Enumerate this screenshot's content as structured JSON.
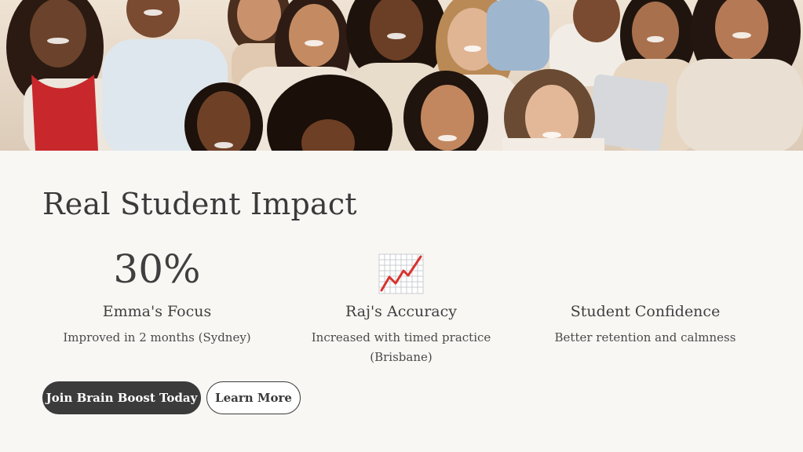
{
  "hero": {
    "image_alt": "Group of smiling students"
  },
  "impact": {
    "title": "Real Student Impact",
    "stats": [
      {
        "value": "30%",
        "heading": "Emma's Focus",
        "description": "Improved in 2 months (Sydney)"
      },
      {
        "icon": "chart-increasing-icon",
        "heading": "Raj's Accuracy",
        "description": "Increased with timed practice (Brisbane)"
      },
      {
        "heading": "Student Confidence",
        "description": "Better retention and calmness"
      }
    ]
  },
  "actions": {
    "primary_label": "Join Brain Boost Today",
    "secondary_label": "Learn More"
  },
  "colors": {
    "background": "#f9f7f4",
    "text": "#3a3a3a",
    "button_dark": "#3b3b3b",
    "chart_line": "#d8332e"
  }
}
